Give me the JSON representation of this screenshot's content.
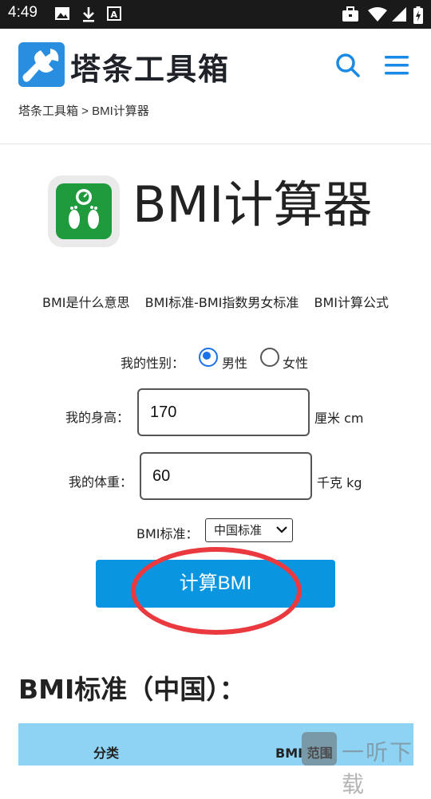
{
  "status_bar": {
    "time": "4:49"
  },
  "header": {
    "logo_text": "塔条工具箱",
    "icons": [
      "search-icon",
      "menu-icon"
    ],
    "accent": "#1a8ae6"
  },
  "breadcrumb": "塔条工具箱 > BMI计算器",
  "tool": {
    "title": "BMI计算器"
  },
  "links": [
    "BMI是什么意思",
    "BMI标准-BMI指数男女标准",
    "BMI计算公式"
  ],
  "form": {
    "gender_label": "我的性别：",
    "gender_options": [
      {
        "label": "男性",
        "checked": true
      },
      {
        "label": "女性",
        "checked": false
      }
    ],
    "height_label": "我的身高：",
    "height_value": "170",
    "height_unit": "厘米 cm",
    "weight_label": "我的体重：",
    "weight_value": "60",
    "weight_unit": "千克 kg",
    "standard_label": "BMI标准：",
    "standard_selected": "中国标准",
    "calc_button": "计算BMI"
  },
  "section": {
    "title": "BMI标准（中国）：",
    "table_headers": [
      "分类",
      "BMI 范围"
    ]
  },
  "watermark": "一听下载",
  "colors": {
    "button": "#0a95e0",
    "table_header": "#8fd3f4",
    "highlight": "#ea3a3f"
  }
}
